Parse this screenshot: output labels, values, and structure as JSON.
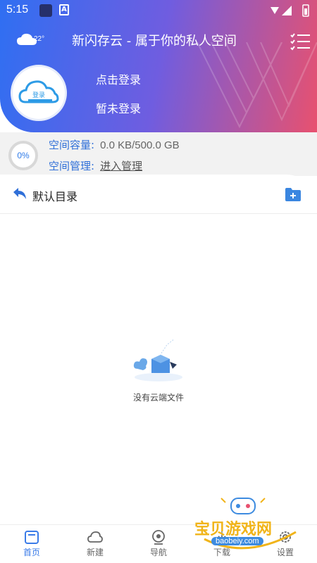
{
  "status": {
    "time": "5:15"
  },
  "weather": {
    "temp": "22°"
  },
  "header": {
    "title": "新闪存云 - 属于你的私人空间",
    "login_link": "点击登录",
    "login_status": "暂未登录",
    "avatar_text": "登录"
  },
  "storage": {
    "percent_label": "0%",
    "capacity_label": "空间容量:",
    "capacity_value": "0.0 KB/500.0 GB",
    "manage_label": "空间管理:",
    "manage_link": "进入管理"
  },
  "directory": {
    "title": "默认目录"
  },
  "empty": {
    "text": "没有云端文件"
  },
  "nav": [
    {
      "label": "首页",
      "icon": "home-icon",
      "active": true
    },
    {
      "label": "新建",
      "icon": "cloud-icon"
    },
    {
      "label": "导航",
      "icon": "navigation-icon"
    },
    {
      "label": "下载",
      "icon": "download-icon"
    },
    {
      "label": "设置",
      "icon": "settings-icon"
    }
  ],
  "watermark": {
    "text": "宝贝游戏网",
    "url": "baobeiy.com"
  },
  "colors": {
    "accent": "#2f6fd8",
    "gradient_start": "#2f6ff2",
    "gradient_end": "#e8516f"
  }
}
